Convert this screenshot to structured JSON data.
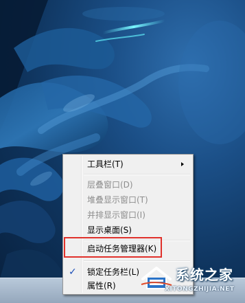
{
  "context_menu": {
    "items": [
      {
        "label": "工具栏(T)",
        "enabled": true,
        "has_submenu": true,
        "checked": false
      },
      {
        "label": "层叠窗口(D)",
        "enabled": false,
        "has_submenu": false,
        "checked": false
      },
      {
        "label": "堆叠显示窗口(T)",
        "enabled": false,
        "has_submenu": false,
        "checked": false
      },
      {
        "label": "并排显示窗口(I)",
        "enabled": false,
        "has_submenu": false,
        "checked": false
      },
      {
        "label": "显示桌面(S)",
        "enabled": true,
        "has_submenu": false,
        "checked": false
      },
      {
        "label": "启动任务管理器(K)",
        "enabled": true,
        "has_submenu": false,
        "checked": false,
        "highlighted": true
      },
      {
        "label": "锁定任务栏(L)",
        "enabled": true,
        "has_submenu": false,
        "checked": true
      },
      {
        "label": "属性(R)",
        "enabled": true,
        "has_submenu": false,
        "checked": false
      }
    ],
    "checkmark_glyph": "✓"
  },
  "watermark": {
    "title": "系统之家",
    "url": "XITONGZHIJIA.NET"
  },
  "colors": {
    "highlight_border": "#e0302a",
    "menu_background": "#f0f0f0",
    "disabled_text": "#8d8d8d",
    "check_color": "#1c4fb8"
  },
  "icons": {
    "submenu_arrow": "triangle-right-icon",
    "check": "checkmark-icon",
    "watermark_logo": "house-logo-icon"
  }
}
